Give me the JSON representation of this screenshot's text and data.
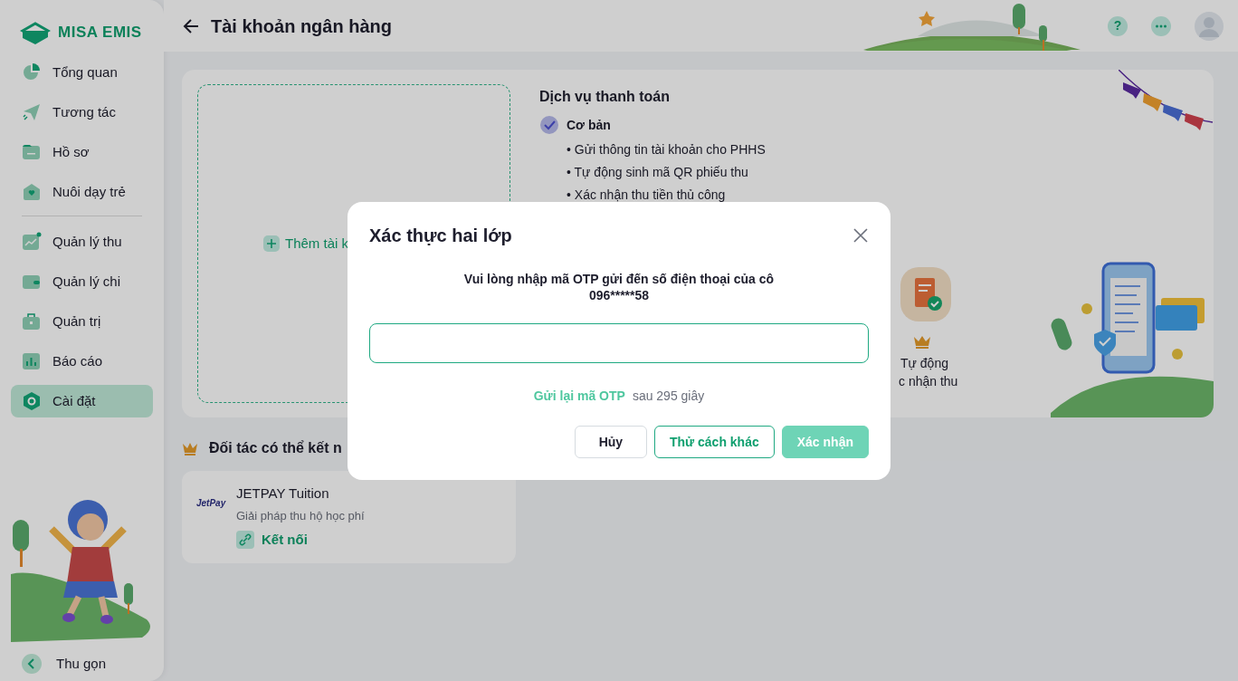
{
  "sidebar": {
    "logo": "MISA EMIS",
    "groups": [
      [
        {
          "label": "Tổng quan",
          "selected": false
        },
        {
          "label": "Tương tác",
          "selected": false
        },
        {
          "label": "Hồ sơ",
          "selected": false
        },
        {
          "label": "Nuôi dạy trẻ",
          "selected": false
        }
      ],
      [
        {
          "label": "Quản lý thu",
          "selected": false
        },
        {
          "label": "Quản lý chi",
          "selected": false
        },
        {
          "label": "Quản trị",
          "selected": false
        },
        {
          "label": "Báo cáo",
          "selected": false
        },
        {
          "label": "Cài đặt",
          "selected": true
        }
      ]
    ],
    "collapse": "Thu gọn"
  },
  "header": {
    "title": "Tài khoản ngân hàng",
    "help": "?"
  },
  "bank_card": {
    "add_account": "Thêm tài k",
    "services_title": "Dịch vụ thanh toán",
    "tier": {
      "label": "Cơ bản",
      "checked": true
    },
    "features": [
      "• Gửi thông tin tài khoản cho PHHS",
      "• Tự động sinh mã QR phiếu thu",
      "• Xác nhận thu tiền thủ công"
    ],
    "premium_tile": {
      "line_1": "Tự động",
      "line_2": "c nhận thu"
    }
  },
  "partners": {
    "heading": "Đối tác có thể kết n",
    "items": [
      {
        "logo": "JetPay",
        "name": "JETPAY Tuition",
        "description": "Giải pháp thu hộ học phí",
        "action": "Kết nối"
      }
    ]
  },
  "modal": {
    "title": "Xác thực hai lớp",
    "message": "Vui lòng nhập mã OTP gửi đến số điện thoại của cô",
    "phone": "096*****58",
    "resend": "Gửi lại mã OTP",
    "countdown": "sau 295 giây",
    "buttons": [
      {
        "label": "Hủy",
        "kind": "secondary",
        "disabled": false
      },
      {
        "label": "Thử cách khác",
        "kind": "outline",
        "disabled": false
      },
      {
        "label": "Xác nhận",
        "kind": "primary",
        "disabled": true
      }
    ]
  }
}
